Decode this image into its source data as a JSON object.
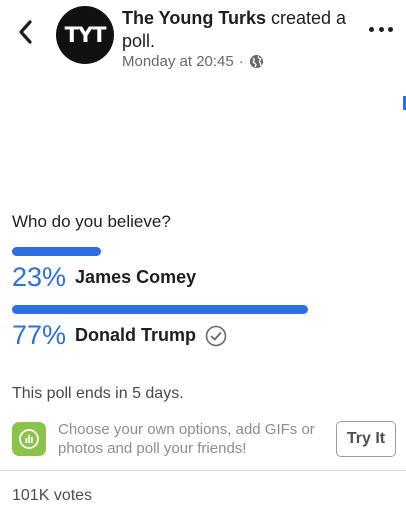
{
  "header": {
    "avatar_text": "TYT",
    "author": "The Young Turks",
    "action": " created a poll.",
    "timestamp": "Monday at 20:45",
    "separator": "·",
    "privacy_icon": "globe-icon",
    "back_icon": "chevron-left-icon",
    "more_icon": "more-dots-icon"
  },
  "poll": {
    "question": "Who do you believe?",
    "options": [
      {
        "percent": "23%",
        "fraction": 0.23,
        "label": "James Comey",
        "selected": false
      },
      {
        "percent": "77%",
        "fraction": 0.77,
        "label": "Donald Trump",
        "selected": true
      }
    ],
    "ends_text": "This poll ends in 5 days."
  },
  "promo": {
    "text": "Choose your own options, add GIFs or photos and poll your friends!",
    "button_label": "Try It"
  },
  "footer": {
    "votes": "101K votes"
  },
  "colors": {
    "accent": "#2d6ee0",
    "promo_icon": "#8bc34a",
    "avatar_bg": "#111111",
    "text": "#1c1e21",
    "muted": "#65676b"
  }
}
